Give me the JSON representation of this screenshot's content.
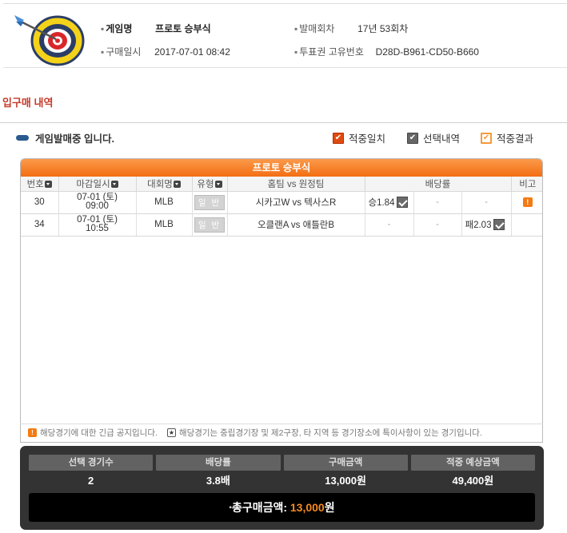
{
  "header": {
    "game_name_label": "게임명",
    "game_name": "프로토 승부식",
    "round_label": "발매회차",
    "round": "17년 53회차",
    "purchase_date_label": "구매일시",
    "purchase_date": "2017-07-01 08:42",
    "ticket_id_label": "투표권 고유번호",
    "ticket_id": "D28D-B961-CD50-B660"
  },
  "section_title": "입구매 내역",
  "status_text": "게임발매중 입니다.",
  "legend": {
    "hit": "적중일치",
    "selected": "선택내역",
    "result": "적중결과"
  },
  "table": {
    "title": "프로토 승부식",
    "columns": [
      "번호",
      "마감일시",
      "대회명",
      "유형",
      "홈팀 vs 원정팀",
      "배당률",
      "비고"
    ],
    "rows": [
      {
        "no": "30",
        "close_date": "07-01 (토)",
        "close_time": "09:00",
        "league": "MLB",
        "type": "일 반",
        "match": "시카고W vs 텍사스R",
        "odds_win": "승1.84",
        "odds_draw": "-",
        "odds_lose": "-",
        "note": "!"
      },
      {
        "no": "34",
        "close_date": "07-01 (토)",
        "close_time": "10:55",
        "league": "MLB",
        "type": "일 반",
        "match": "오클랜A vs 애틀란B",
        "odds_win": "-",
        "odds_draw": "-",
        "odds_lose": "패2.03",
        "note": ""
      }
    ]
  },
  "notes": {
    "urgent": "해당경기에 대한 긴급 공지입니다.",
    "neutral": "해당경기는 중립경기장 및 제2구장, 타 지역 등 경기장소에 특이사항이 있는 경기입니다."
  },
  "summary": {
    "labels": [
      "선택 경기수",
      "배당률",
      "구매금액",
      "적중 예상금액"
    ],
    "values": [
      "2",
      "3.8배",
      "13,000원",
      "49,400원"
    ],
    "total_label": "총구매금액: ",
    "total_amount": "13,000",
    "total_unit": "원"
  },
  "colors": {
    "accent": "#f36e13",
    "section_title": "#c63a2a",
    "summary_bg": "#333333"
  }
}
